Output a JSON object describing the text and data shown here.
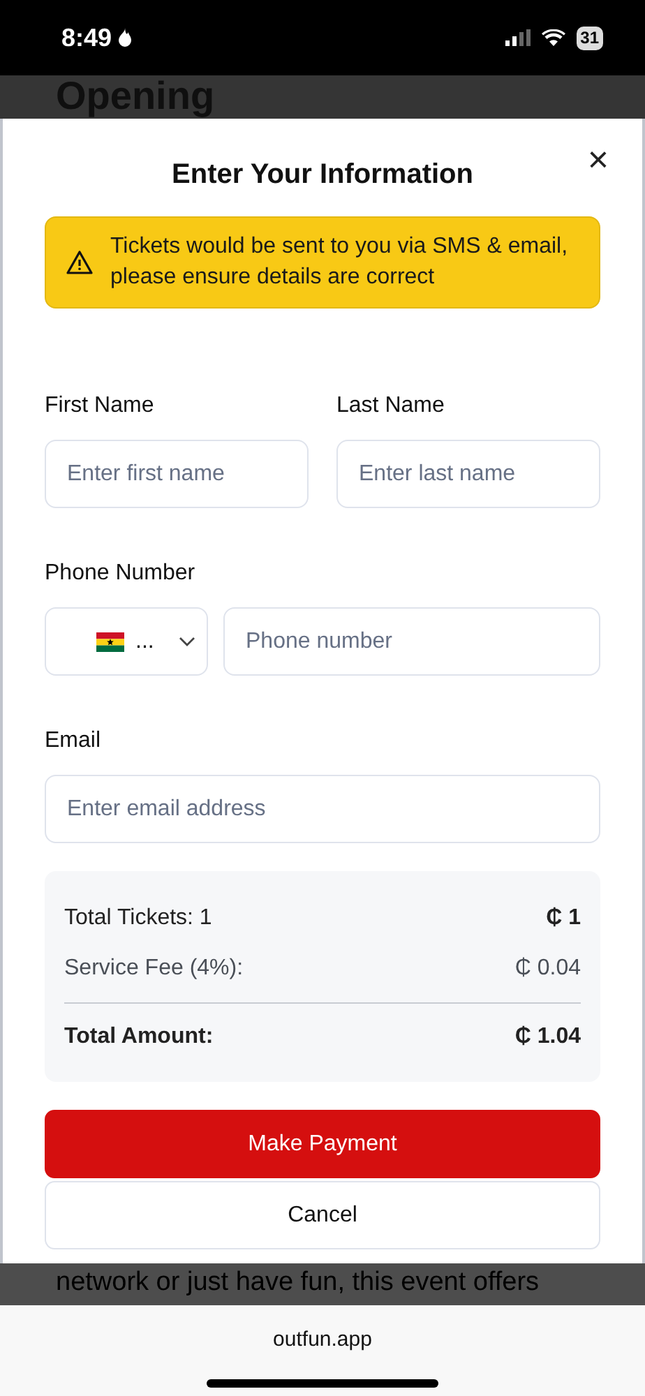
{
  "status_bar": {
    "time": "8:49",
    "battery": "31"
  },
  "background": {
    "heading": "Opening",
    "text": "network or just have fun, this event offers"
  },
  "modal": {
    "title": "Enter Your Information",
    "close": "×",
    "alert": "Tickets would be sent to you via SMS & email, please ensure details are correct",
    "fields": [
      {
        "kind": "pair",
        "items": [
          {
            "label": "First Name",
            "placeholder": "Enter first name"
          },
          {
            "label": "Last Name",
            "placeholder": "Enter last name"
          }
        ]
      },
      {
        "kind": "phone",
        "label": "Phone Number",
        "country": "...",
        "placeholder": "Phone number"
      },
      {
        "kind": "single",
        "label": "Email",
        "placeholder": "Enter email address"
      }
    ],
    "summary": [
      {
        "kind": "line",
        "label": "Total Tickets: 1",
        "value": "₵ 1"
      },
      {
        "kind": "fee",
        "label": "Service Fee (4%):",
        "value": "₵ 0.04"
      },
      {
        "kind": "total",
        "label": "Total Amount:",
        "value": "₵ 1.04"
      }
    ],
    "buttons": [
      {
        "kind": "primary",
        "label": "Make Payment"
      },
      {
        "kind": "secondary",
        "label": "Cancel"
      }
    ]
  },
  "browser": {
    "url": "outfun.app"
  }
}
